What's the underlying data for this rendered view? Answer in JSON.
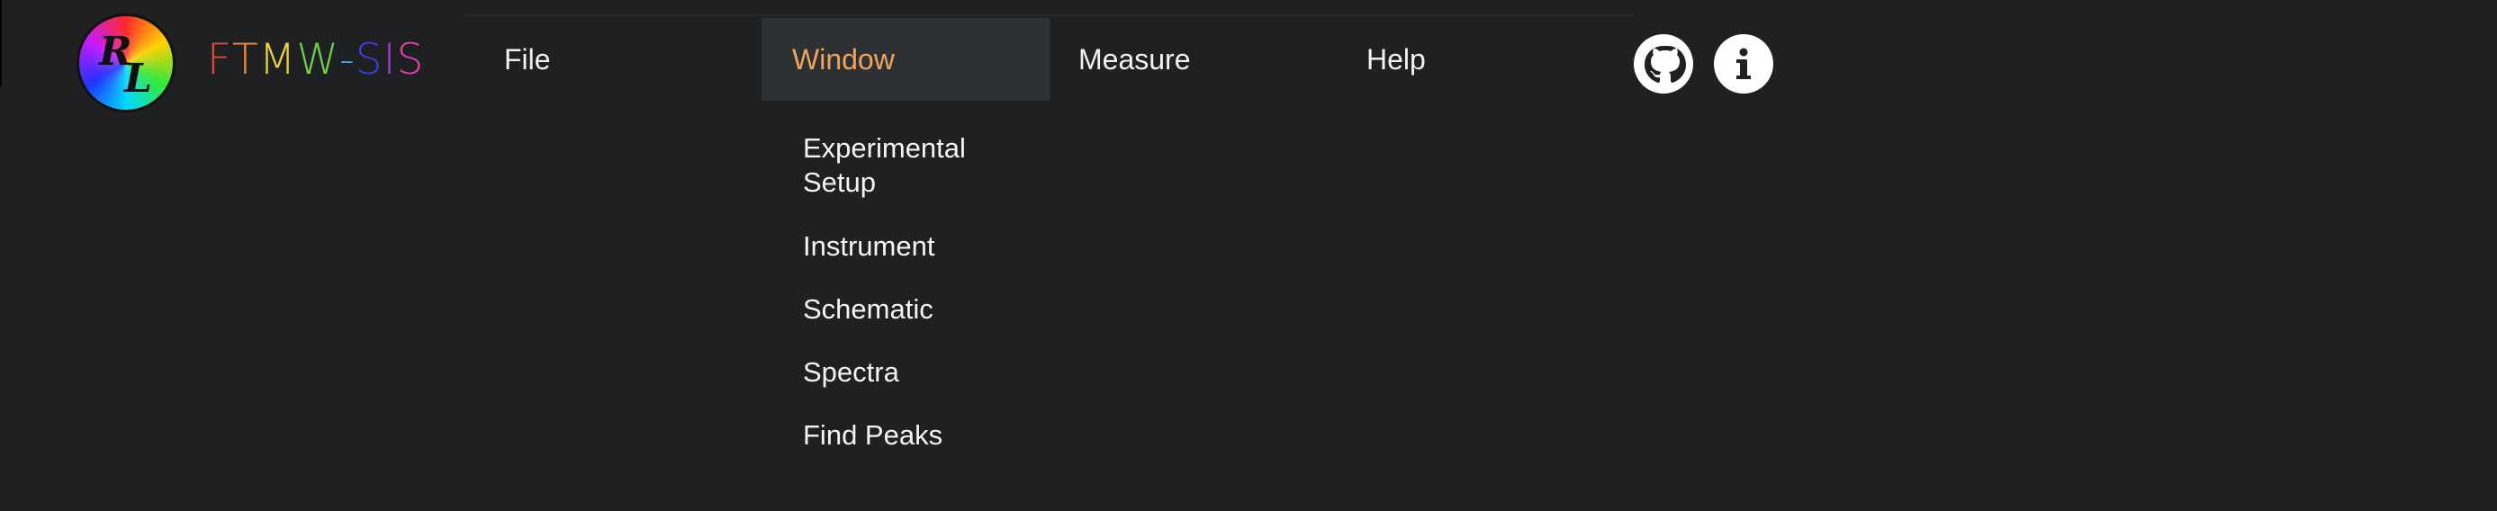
{
  "app": {
    "brand_letters": [
      {
        "char": "F",
        "color": "#e0473b"
      },
      {
        "char": "T",
        "color": "#f08b35"
      },
      {
        "char": "M",
        "color": "#e9d23a"
      },
      {
        "char": "W",
        "color": "#6fd24b"
      },
      {
        "char": "-",
        "color": "#4aa3e8"
      },
      {
        "char": "S",
        "color": "#3d3de2"
      },
      {
        "char": "I",
        "color": "#a23ad8"
      },
      {
        "char": "S",
        "color": "#e23fb0"
      }
    ],
    "logo": {
      "icon": "rl-rainbow-logo",
      "letter_top": "R",
      "letter_bottom": "L"
    }
  },
  "menu": {
    "file": "File",
    "window": "Window",
    "measure": "Measure",
    "help": "Help",
    "active": "Window",
    "active_color": "#f0a35a"
  },
  "window_menu": {
    "items": [
      "Experimental Setup",
      "Instrument",
      "Schematic",
      "Spectra",
      "Find Peaks"
    ]
  },
  "icons": {
    "github": "github-icon",
    "info": "info-icon"
  },
  "colors": {
    "background": "#1f2022",
    "active_bg": "#2e3134",
    "text": "#f2f2f2"
  }
}
